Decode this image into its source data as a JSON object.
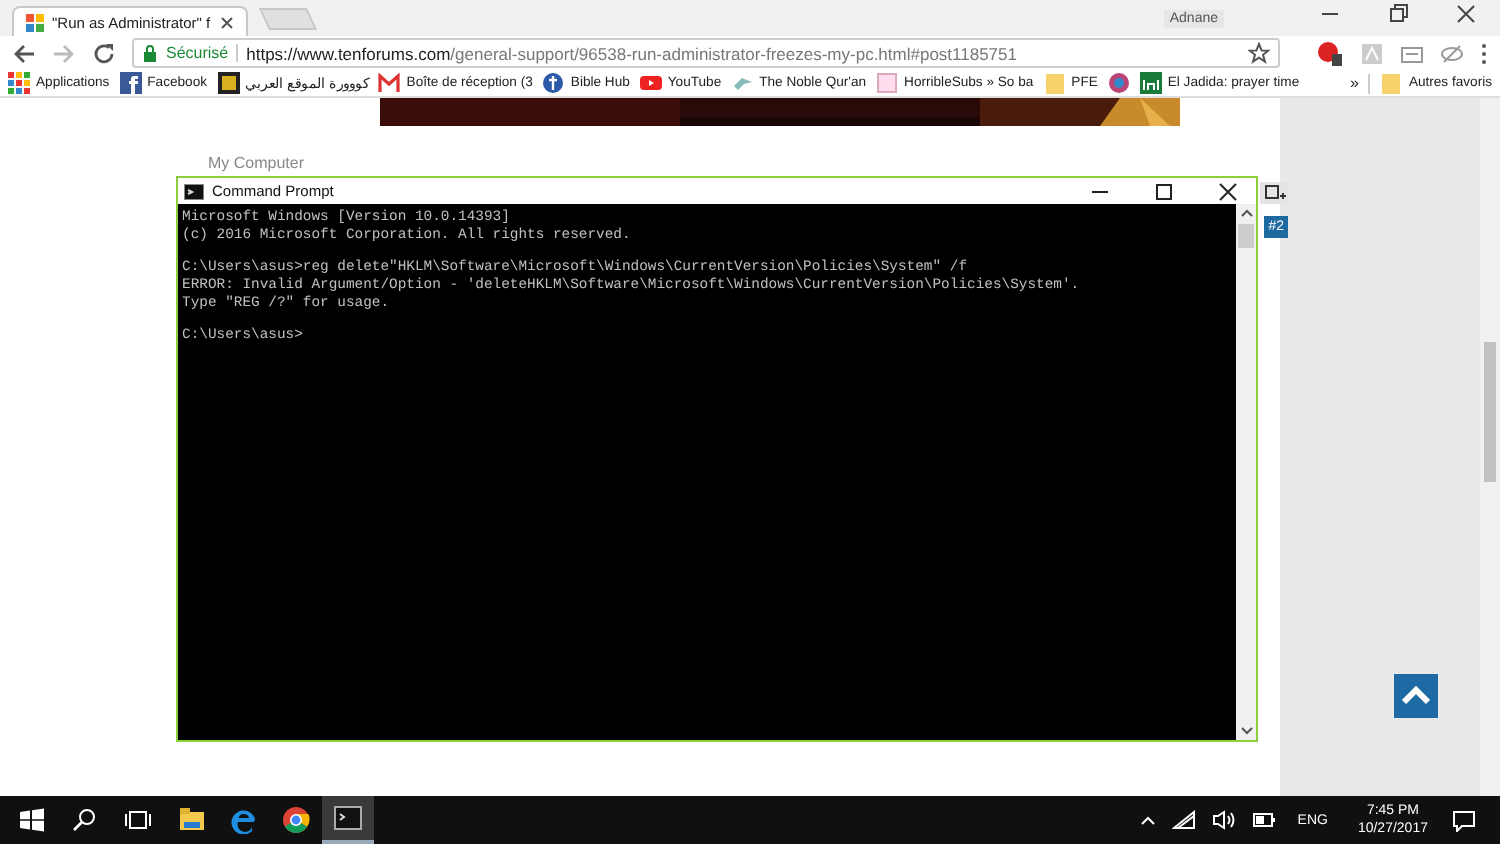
{
  "browser": {
    "tab": {
      "title": "\"Run as Administrator\" f"
    },
    "profile_name": "Adnane",
    "address": {
      "secure_label": "Sécurisé",
      "url_host": "https://www.tenforums.com",
      "url_path": "/general-support/96538-run-administrator-freezes-my-pc.html#post1185751"
    },
    "bookmarks": [
      {
        "label": "Applications",
        "kind": "apps"
      },
      {
        "label": "Facebook",
        "kind": "facebook"
      },
      {
        "label": "كووورة الموقع العربي",
        "kind": "kooora"
      },
      {
        "label": "Boîte de réception (3",
        "kind": "mail"
      },
      {
        "label": "Bible Hub",
        "kind": "cross"
      },
      {
        "label": "YouTube",
        "kind": "youtube"
      },
      {
        "label": "The Noble Qur'an",
        "kind": "bird"
      },
      {
        "label": "HorribleSubs » So ba",
        "kind": "page"
      },
      {
        "label": "PFE",
        "kind": "folder"
      },
      {
        "kind": "badge"
      },
      {
        "label": "El Jadida: prayer time",
        "kind": "mosque"
      }
    ],
    "overflow": "»",
    "other_bookmarks": "Autres favoris"
  },
  "page": {
    "section_label": "My Computer",
    "post_number": "#2"
  },
  "console": {
    "title": "Command Prompt",
    "blocks": [
      [
        "Microsoft Windows [Version 10.0.14393]",
        "(c) 2016 Microsoft Corporation. All rights reserved."
      ],
      [
        "C:\\Users\\asus>reg delete\"HKLM\\Software\\Microsoft\\Windows\\CurrentVersion\\Policies\\System\" /f",
        "ERROR: Invalid Argument/Option - 'deleteHKLM\\Software\\Microsoft\\Windows\\CurrentVersion\\Policies\\System'.",
        "Type \"REG /?\" for usage."
      ],
      [
        "C:\\Users\\asus>"
      ]
    ]
  },
  "taskbar": {
    "apps": [
      {
        "kind": "explorer",
        "active": false
      },
      {
        "kind": "edge",
        "active": false
      },
      {
        "kind": "chrome",
        "active": false
      },
      {
        "kind": "console",
        "active": true
      }
    ],
    "language": "ENG",
    "time": "7:45 PM",
    "date": "10/27/2017"
  }
}
